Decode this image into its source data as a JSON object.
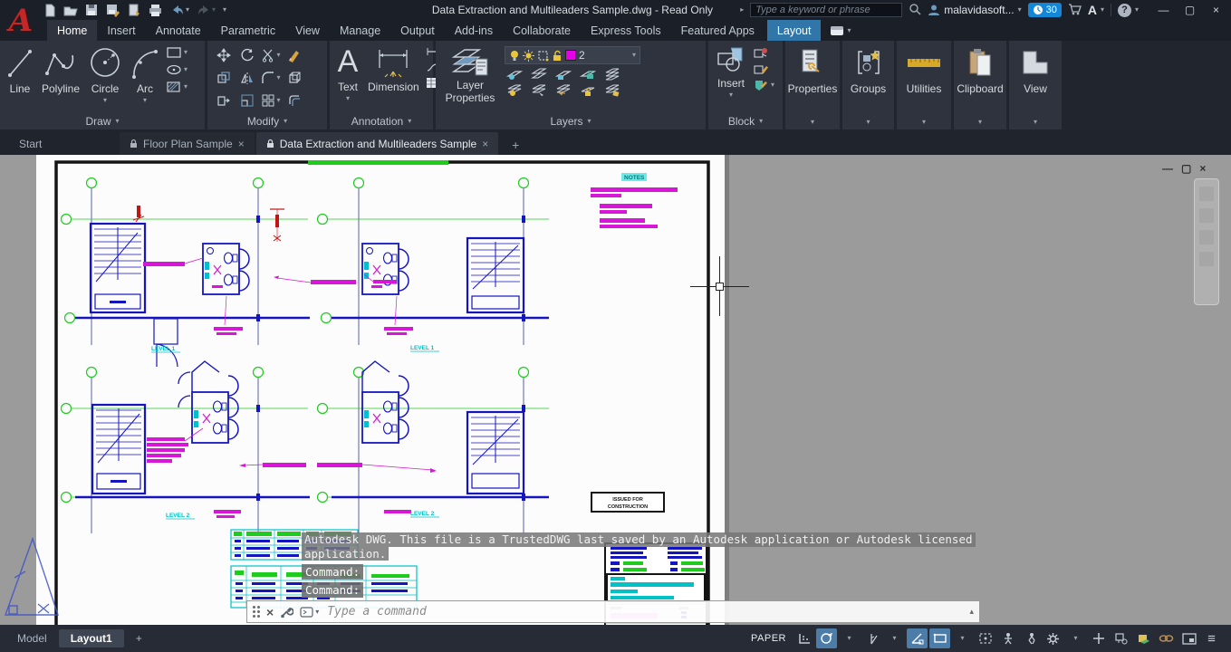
{
  "icons": {
    "caret_down": "▾",
    "caret_up": "▴",
    "close": "×",
    "minimize": "—",
    "maximize": "▢",
    "plus": "+",
    "menu": "≡",
    "chevron_right": "▸",
    "help": "?",
    "autodesk_a": "A"
  },
  "colors": {
    "accent_blue": "#3076a8",
    "cad_blue": "#1515c0",
    "cad_cyan": "#00c2c6",
    "cad_magenta": "#d816d8",
    "cad_green": "#1ecb1e",
    "cad_red": "#c41414",
    "layer_swatch": "#e800e8",
    "status_active": "#4c7ca8"
  },
  "title_bar": {
    "title": "Data Extraction and Multileaders Sample.dwg - Read Only",
    "search_placeholder": "Type a keyword or phrase",
    "user_name": "malavidasoft...",
    "notification_count": "30"
  },
  "ribbon": {
    "tabs": [
      {
        "label": "Home",
        "active": true
      },
      {
        "label": "Insert"
      },
      {
        "label": "Annotate"
      },
      {
        "label": "Parametric"
      },
      {
        "label": "View"
      },
      {
        "label": "Manage"
      },
      {
        "label": "Output"
      },
      {
        "label": "Add-ins"
      },
      {
        "label": "Collaborate"
      },
      {
        "label": "Express Tools"
      },
      {
        "label": "Featured Apps"
      },
      {
        "label": "Layout",
        "highlighted": true
      }
    ],
    "draw": {
      "label": "Draw",
      "buttons": [
        "Line",
        "Polyline",
        "Circle",
        "Arc"
      ]
    },
    "modify": {
      "label": "Modify"
    },
    "annotation": {
      "label": "Annotation",
      "text_label": "Text",
      "dimension_label": "Dimension"
    },
    "layers": {
      "label": "Layers",
      "layer_properties_label": "Layer Properties",
      "current_layer": "2"
    },
    "block": {
      "label": "Block",
      "insert_label": "Insert"
    },
    "collapsed_panels": [
      "Properties",
      "Groups",
      "Utilities",
      "Clipboard",
      "View"
    ]
  },
  "file_tabs": {
    "tabs": [
      {
        "label": "Start"
      },
      {
        "label": "Floor Plan Sample",
        "locked": true
      },
      {
        "label": "Data Extraction and Multileaders Sample",
        "locked": true,
        "active": true
      }
    ]
  },
  "drawing": {
    "level_labels": [
      "LEVEL 1",
      "LEVEL 1",
      "LEVEL 2",
      "LEVEL 2"
    ],
    "notes_title": "NOTES",
    "stamp": {
      "line1": "ISSUED FOR",
      "line2": "CONSTRUCTION"
    }
  },
  "overlays": {
    "trusted_message_line1": "Autodesk DWG.  This file is a TrustedDWG last saved by an Autodesk application or Autodesk licensed",
    "trusted_message_line2": "application.",
    "command_history": [
      "Command:",
      "Command:"
    ],
    "command_placeholder": "Type a command"
  },
  "status_bar": {
    "model_tab": "Model",
    "layout_tab": "Layout1",
    "new_layout": "+",
    "space_label": "PAPER"
  }
}
